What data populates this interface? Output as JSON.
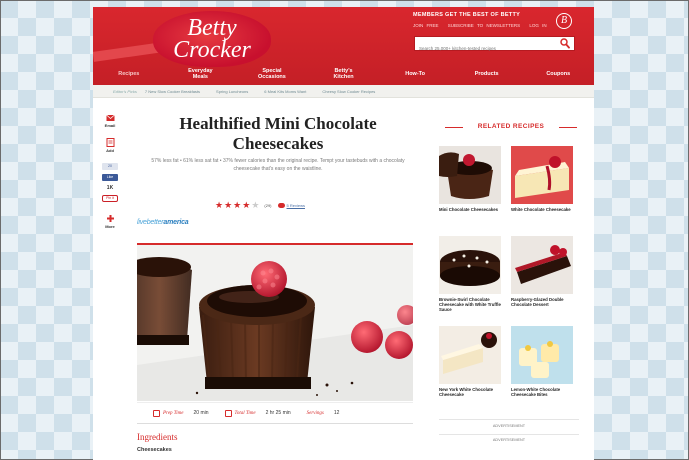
{
  "header": {
    "logo_line1": "Betty",
    "logo_line2": "Crocker",
    "members_text": "MEMBERS GET THE BEST OF BETTY",
    "top_links": [
      "JOIN FREE",
      "SUBSCRIBE TO NEWSLETTERS",
      "LOG IN"
    ],
    "b_badge": "B",
    "search_placeholder": "Search 25,000+ kitchen-tested recipes"
  },
  "nav": [
    {
      "label": "Recipes",
      "active": true
    },
    {
      "label": "Everyday\nMeals"
    },
    {
      "label": "Special\nOccasions"
    },
    {
      "label": "Betty's\nKitchen"
    },
    {
      "label": "How-To"
    },
    {
      "label": "Products"
    },
    {
      "label": "Coupons"
    }
  ],
  "subnav": {
    "label": "Editor's Picks",
    "links": [
      "7 New Slow Cooker Breakfasts",
      "Spring Luncheons",
      "6 Meal Kits Moms Want",
      "Cheesy Slow Cooker Recipes"
    ]
  },
  "share": {
    "email_label": "Email",
    "add_label": "Add",
    "fb_like": "Like",
    "fb_count": "20",
    "count": "1K",
    "pin_label": "Pin it",
    "more_label": "More"
  },
  "recipe": {
    "title": "Healthified Mini Chocolate Cheesecakes",
    "intro": "57% less fat • 61% less sat fat • 37% fewer calories than the original recipe. Tempt your tastebuds with a chocolaty cheesecake that's easy on the waistline.",
    "rating_stars": 4,
    "rating_max": 5,
    "rating_count": "(29)",
    "reviews_link": "5 Reviews",
    "partner_pre": "livebetter",
    "partner_post": "america",
    "prep_label": "Prep Time",
    "prep_value": "20 min",
    "total_label": "Total Time",
    "total_value": "2 hr 25 min",
    "servings_label": "Servings",
    "servings_value": "12",
    "ingredients_heading": "Ingredients",
    "ingredients_sub": "Cheesecakes"
  },
  "related": {
    "heading": "RELATED RECIPES",
    "items": [
      {
        "label": "Mini Chocolate Cheesecakes"
      },
      {
        "label": "White Chocolate Cheesecake"
      },
      {
        "label": "Brownie-Swirl Chocolate Cheesecake with White Truffle Sauce"
      },
      {
        "label": "Raspberry-Glazed Double Chocolate Dessert"
      },
      {
        "label": "New York White Chocolate Cheesecake"
      },
      {
        "label": "Lemon-White Chocolate Cheesecake Bites"
      }
    ]
  },
  "ads": [
    "ADVERTISEMENT",
    "ADVERTISEMENT"
  ],
  "colors": {
    "brand_red": "#d62b2b",
    "link_blue": "#4a6fa5"
  }
}
